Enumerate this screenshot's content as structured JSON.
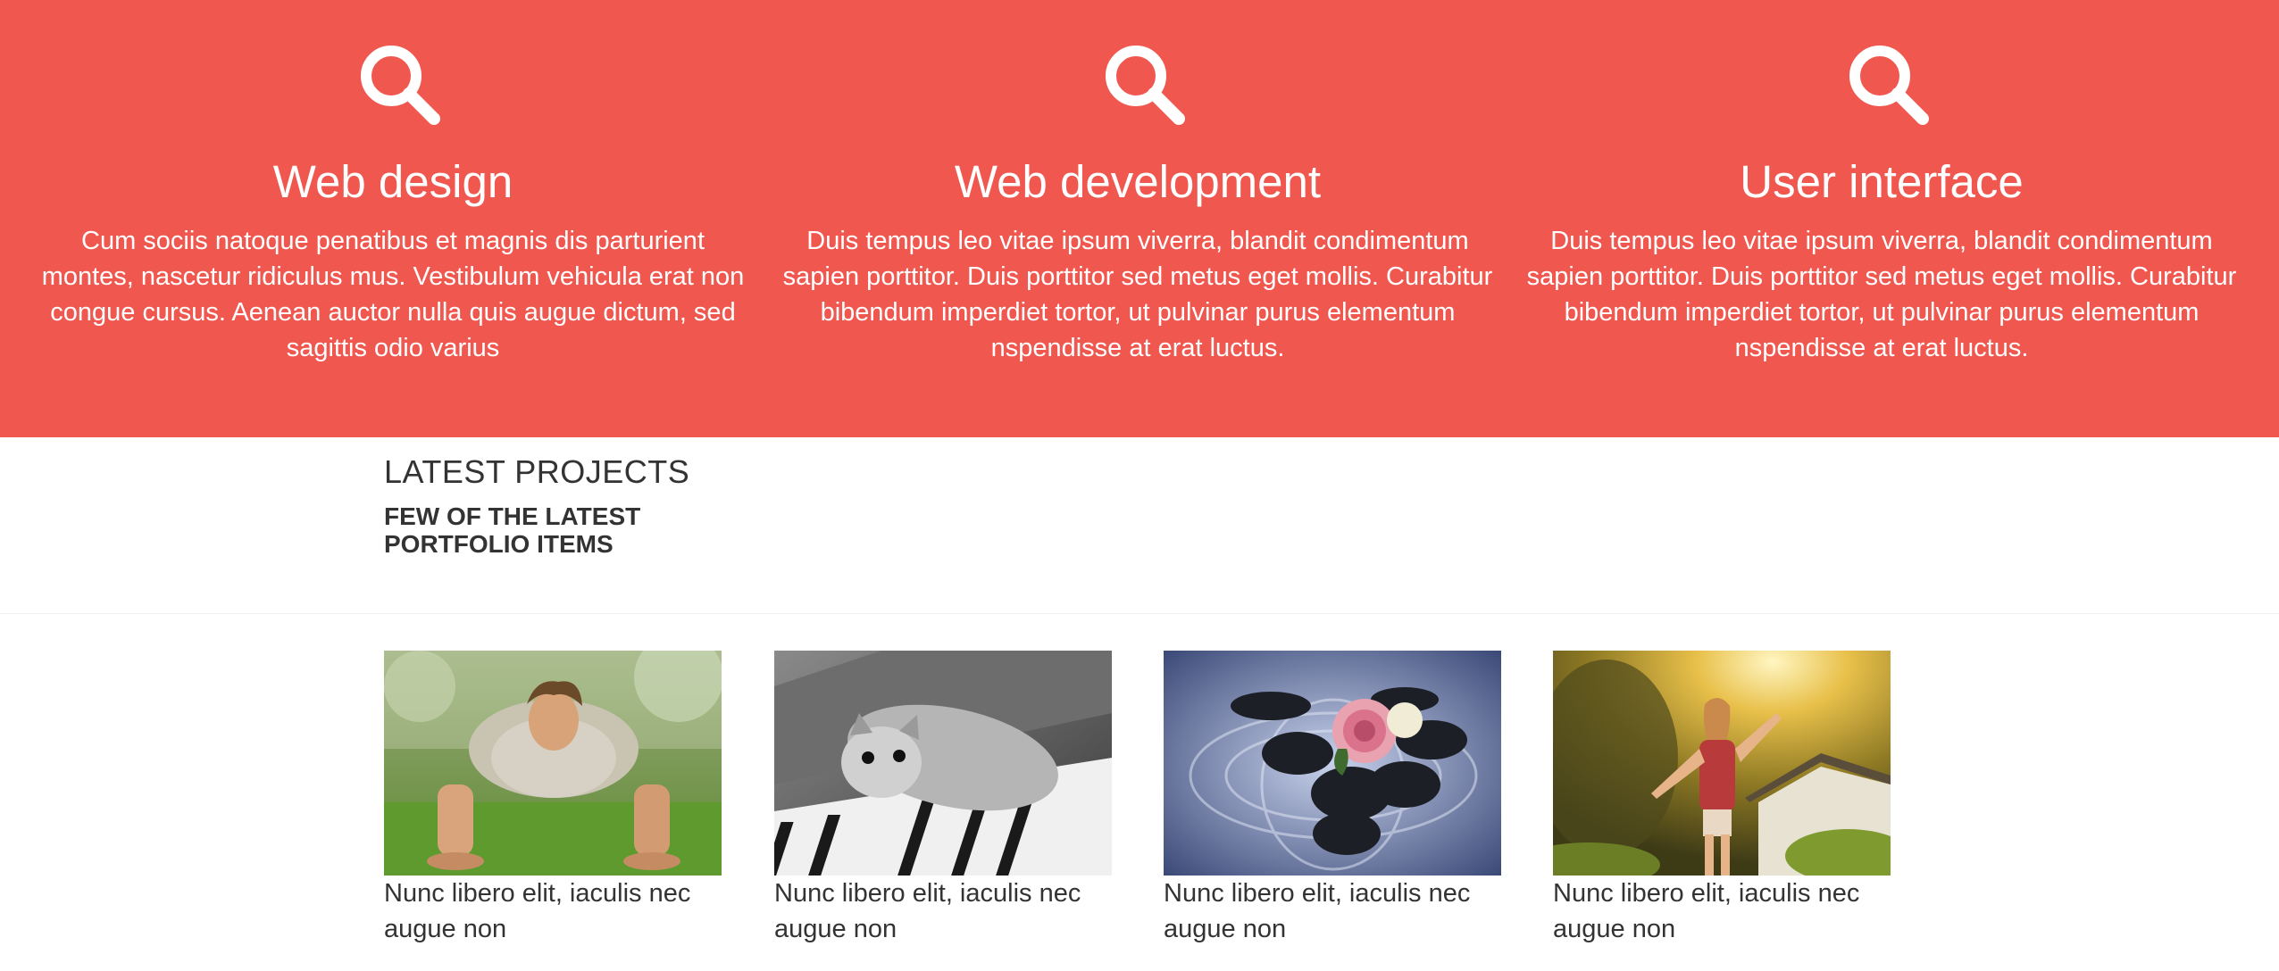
{
  "services": [
    {
      "icon": "search-icon",
      "title": "Web design",
      "text": "Cum sociis natoque penatibus et magnis dis parturient montes, nascetur ridiculus mus. Vestibulum vehicula erat non congue cursus. Aenean auctor nulla quis augue dictum, sed sagittis odio varius"
    },
    {
      "icon": "search-icon",
      "title": "Web development",
      "text": "Duis tempus leo vitae ipsum viverra, blandit condimentum sapien porttitor. Duis porttitor sed metus eget mollis. Curabitur bibendum imperdiet tortor, ut pulvinar purus elementum nspendisse at erat luctus."
    },
    {
      "icon": "search-icon",
      "title": "User interface",
      "text": "Duis tempus leo vitae ipsum viverra, blandit condimentum sapien porttitor. Duis porttitor sed metus eget mollis. Curabitur bibendum imperdiet tortor, ut pulvinar purus elementum nspendisse at erat luctus."
    }
  ],
  "portfolio": {
    "title": "LATEST PROJECTS",
    "subtitle": "FEW OF THE LATEST PORTFOLIO ITEMS",
    "items": [
      {
        "caption": "Nunc libero elit, iaculis nec augue non"
      },
      {
        "caption": "Nunc libero elit, iaculis nec augue non"
      },
      {
        "caption": "Nunc libero elit, iaculis nec augue non"
      },
      {
        "caption": "Nunc libero elit, iaculis nec augue non"
      }
    ]
  },
  "colors": {
    "accent": "#ef574f",
    "text": "#333333",
    "background": "#ffffff"
  }
}
